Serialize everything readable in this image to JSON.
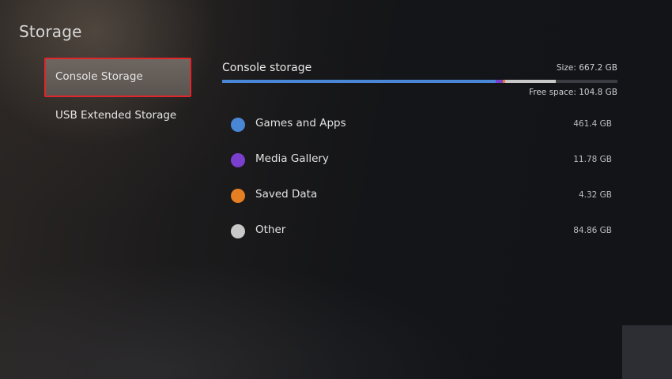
{
  "page": {
    "title": "Storage"
  },
  "sidebar": {
    "items": [
      {
        "label": "Console Storage",
        "selected": true
      },
      {
        "label": "USB Extended Storage",
        "selected": false
      }
    ]
  },
  "console_storage": {
    "title": "Console storage",
    "size_text": "Size: 667.2 GB",
    "free_text": "Free space: 104.8 GB",
    "categories": [
      {
        "label": "Games and Apps",
        "value": "461.4 GB",
        "color": "#4a86d6"
      },
      {
        "label": "Media Gallery",
        "value": "11.78 GB",
        "color": "#7a3fcf"
      },
      {
        "label": "Saved Data",
        "value": "4.32 GB",
        "color": "#e67e22"
      },
      {
        "label": "Other",
        "value": "84.86 GB",
        "color": "#c8c8c8"
      }
    ],
    "usage_bar": {
      "total_gb": 667.2,
      "segments": [
        {
          "name": "Games and Apps",
          "gb": 461.4,
          "color": "#4a86d6"
        },
        {
          "name": "Media Gallery",
          "gb": 11.78,
          "color": "#7a3fcf"
        },
        {
          "name": "Saved Data",
          "gb": 4.32,
          "color": "#e67e22"
        },
        {
          "name": "Other",
          "gb": 84.86,
          "color": "#c8c8c8"
        }
      ],
      "free_gb": 104.8,
      "track_color": "#3a3c42"
    }
  }
}
